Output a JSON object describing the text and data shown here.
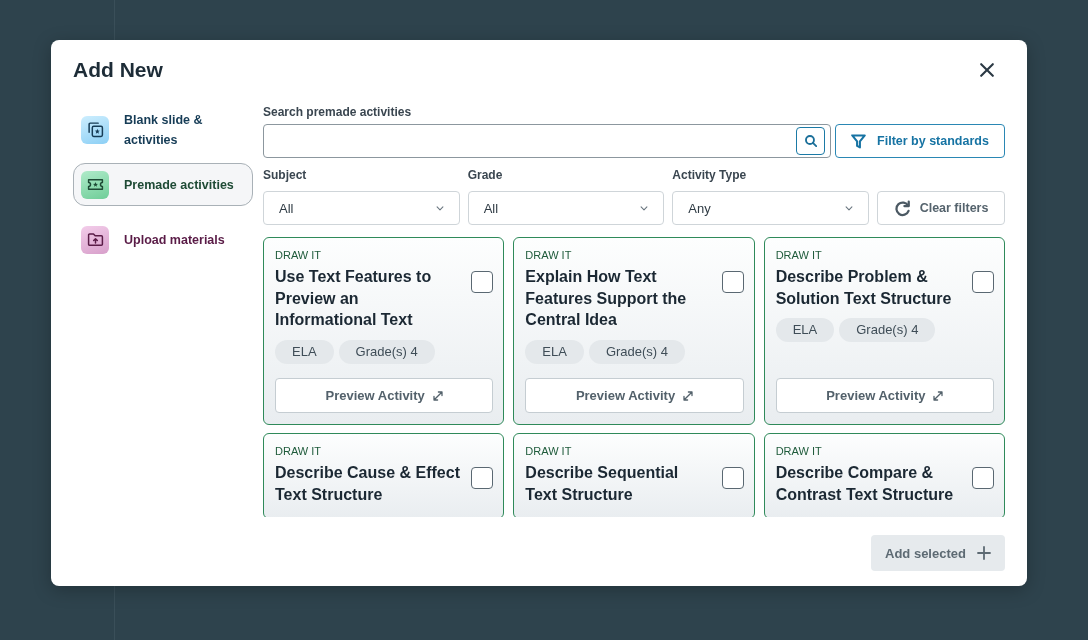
{
  "dialog": {
    "title": "Add New"
  },
  "sidebar": {
    "items": [
      {
        "kind": "blank",
        "label": "Blank slide & activities",
        "selected": false
      },
      {
        "kind": "premade",
        "label": "Premade activities",
        "selected": true
      },
      {
        "kind": "upload",
        "label": "Upload materials",
        "selected": false
      }
    ]
  },
  "search": {
    "label": "Search premade activities",
    "filter_button": "Filter by standards"
  },
  "filters": {
    "dropdowns": [
      {
        "label": "Subject",
        "value": "All"
      },
      {
        "label": "Grade",
        "value": "All"
      },
      {
        "label": "Activity Type",
        "value": "Any"
      }
    ],
    "clear_button": "Clear filters"
  },
  "activities": [
    {
      "type": "DRAW IT",
      "title": "Use Text Features to Preview an Informational Text",
      "checked": false,
      "tags": [
        "ELA",
        "Grade(s) 4"
      ],
      "button": "Preview Activity"
    },
    {
      "type": "DRAW IT",
      "title": "Explain How Text Features Support the Central Idea",
      "checked": false,
      "tags": [
        "ELA",
        "Grade(s) 4"
      ],
      "button": "Preview Activity"
    },
    {
      "type": "DRAW IT",
      "title": "Describe Problem & Solution Text Structure",
      "checked": false,
      "tags": [
        "ELA",
        "Grade(s) 4"
      ],
      "button": "Preview Activity"
    },
    {
      "type": "DRAW IT",
      "title": "Describe Cause & Effect Text Structure",
      "checked": false
    },
    {
      "type": "DRAW IT",
      "title": "Describe Sequential Text Structure",
      "checked": false
    },
    {
      "type": "DRAW IT",
      "title": "Describe Compare & Contrast Text Structure",
      "checked": false
    }
  ],
  "footer": {
    "add_button": {
      "label": "Add selected",
      "disabled": true
    }
  }
}
